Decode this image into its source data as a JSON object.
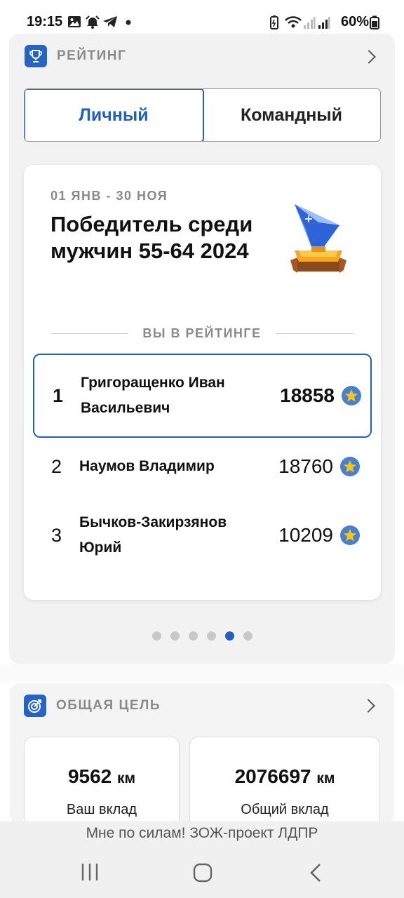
{
  "status_bar": {
    "time": "19:15",
    "battery_percent": "60%",
    "icons": [
      "gallery-icon",
      "alarm-icon",
      "telegram-icon",
      "dot-icon",
      "battery-saver-icon",
      "wifi-icon",
      "signal-icon",
      "signal-icon",
      "battery-icon"
    ]
  },
  "rating": {
    "title": "РЕЙТИНГ",
    "icon": "trophy-icon",
    "tabs": [
      {
        "label": "Личный",
        "active": true
      },
      {
        "label": "Командный",
        "active": false
      }
    ],
    "card": {
      "period": "01 ЯНВ - 30 НОЯ",
      "award_title": "Победитель среди мужчин 55-64 2024",
      "divider_label": "ВЫ В РЕЙТИНГЕ",
      "rows": [
        {
          "rank": "1",
          "name": "Григоращенко Иван Васильевич",
          "score": "18858",
          "is_me": true
        },
        {
          "rank": "2",
          "name": "Наумов Владимир",
          "score": "18760",
          "is_me": false
        },
        {
          "rank": "3",
          "name": "Бычков-Закирзянов Юрий",
          "score": "10209",
          "is_me": false
        }
      ]
    },
    "pagination": {
      "total": 6,
      "active_index": 4
    }
  },
  "goal": {
    "title": "ОБЩАЯ ЦЕЛЬ",
    "icon": "target-icon",
    "stats": [
      {
        "value": "9562",
        "unit": "км",
        "label": "Ваш вклад"
      },
      {
        "value": "2076697",
        "unit": "км",
        "label": "Общий вклад"
      }
    ]
  },
  "footer": {
    "text": "Мне по силам! ЗОЖ-проект ЛДПР"
  },
  "colors": {
    "accent": "#1f5fbf",
    "star_bg": "#4a7fd0",
    "star": "#f5c518",
    "muted": "#8a8a8a"
  }
}
